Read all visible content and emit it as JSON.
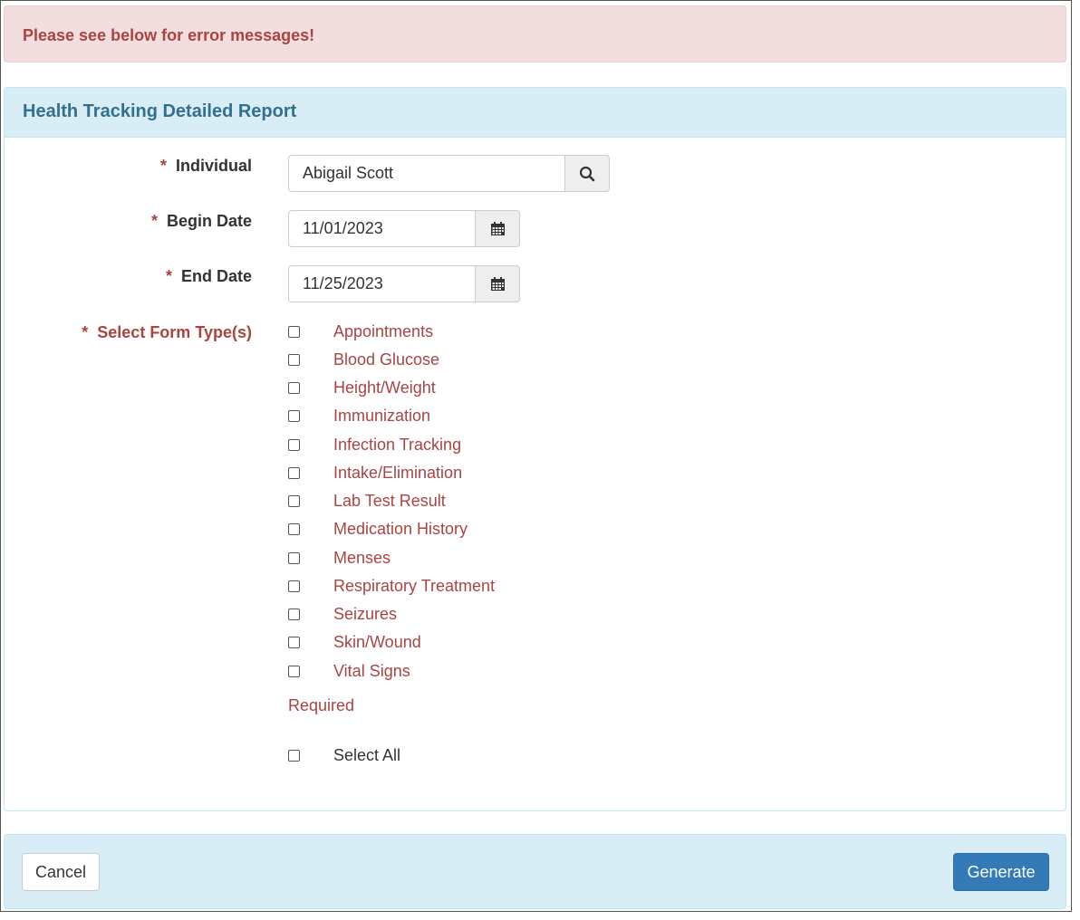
{
  "alert": {
    "message": "Please see below for error messages!"
  },
  "panel": {
    "title": "Health Tracking Detailed Report"
  },
  "fields": {
    "required_marker": "*",
    "individual": {
      "label": "Individual",
      "value": "Abigail Scott",
      "icon": "search-icon"
    },
    "begin_date": {
      "label": "Begin Date",
      "value": "11/01/2023",
      "icon": "calendar-icon"
    },
    "end_date": {
      "label": "End Date",
      "value": "11/25/2023",
      "icon": "calendar-icon"
    },
    "form_types": {
      "label": "Select Form Type(s)",
      "options": [
        "Appointments",
        "Blood Glucose",
        "Height/Weight",
        "Immunization",
        "Infection Tracking",
        "Intake/Elimination",
        "Lab Test Result",
        "Medication History",
        "Menses",
        "Respiratory Treatment",
        "Seizures",
        "Skin/Wound",
        "Vital Signs"
      ],
      "error": "Required",
      "select_all": "Select All"
    }
  },
  "footer": {
    "cancel_label": "Cancel",
    "generate_label": "Generate"
  },
  "colors": {
    "error": "#a94442",
    "heading": "#31708f",
    "primary": "#337ab7",
    "panel_bg": "#d9edf7"
  }
}
